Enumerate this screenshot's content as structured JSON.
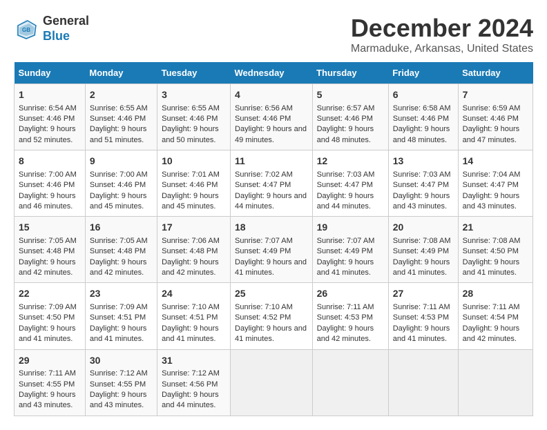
{
  "logo": {
    "line1": "General",
    "line2": "Blue"
  },
  "title": "December 2024",
  "subtitle": "Marmaduke, Arkansas, United States",
  "days_of_week": [
    "Sunday",
    "Monday",
    "Tuesday",
    "Wednesday",
    "Thursday",
    "Friday",
    "Saturday"
  ],
  "weeks": [
    [
      {
        "day": "1",
        "rise": "Sunrise: 6:54 AM",
        "set": "Sunset: 4:46 PM",
        "daylight": "Daylight: 9 hours and 52 minutes."
      },
      {
        "day": "2",
        "rise": "Sunrise: 6:55 AM",
        "set": "Sunset: 4:46 PM",
        "daylight": "Daylight: 9 hours and 51 minutes."
      },
      {
        "day": "3",
        "rise": "Sunrise: 6:55 AM",
        "set": "Sunset: 4:46 PM",
        "daylight": "Daylight: 9 hours and 50 minutes."
      },
      {
        "day": "4",
        "rise": "Sunrise: 6:56 AM",
        "set": "Sunset: 4:46 PM",
        "daylight": "Daylight: 9 hours and 49 minutes."
      },
      {
        "day": "5",
        "rise": "Sunrise: 6:57 AM",
        "set": "Sunset: 4:46 PM",
        "daylight": "Daylight: 9 hours and 48 minutes."
      },
      {
        "day": "6",
        "rise": "Sunrise: 6:58 AM",
        "set": "Sunset: 4:46 PM",
        "daylight": "Daylight: 9 hours and 48 minutes."
      },
      {
        "day": "7",
        "rise": "Sunrise: 6:59 AM",
        "set": "Sunset: 4:46 PM",
        "daylight": "Daylight: 9 hours and 47 minutes."
      }
    ],
    [
      {
        "day": "8",
        "rise": "Sunrise: 7:00 AM",
        "set": "Sunset: 4:46 PM",
        "daylight": "Daylight: 9 hours and 46 minutes."
      },
      {
        "day": "9",
        "rise": "Sunrise: 7:00 AM",
        "set": "Sunset: 4:46 PM",
        "daylight": "Daylight: 9 hours and 45 minutes."
      },
      {
        "day": "10",
        "rise": "Sunrise: 7:01 AM",
        "set": "Sunset: 4:46 PM",
        "daylight": "Daylight: 9 hours and 45 minutes."
      },
      {
        "day": "11",
        "rise": "Sunrise: 7:02 AM",
        "set": "Sunset: 4:47 PM",
        "daylight": "Daylight: 9 hours and 44 minutes."
      },
      {
        "day": "12",
        "rise": "Sunrise: 7:03 AM",
        "set": "Sunset: 4:47 PM",
        "daylight": "Daylight: 9 hours and 44 minutes."
      },
      {
        "day": "13",
        "rise": "Sunrise: 7:03 AM",
        "set": "Sunset: 4:47 PM",
        "daylight": "Daylight: 9 hours and 43 minutes."
      },
      {
        "day": "14",
        "rise": "Sunrise: 7:04 AM",
        "set": "Sunset: 4:47 PM",
        "daylight": "Daylight: 9 hours and 43 minutes."
      }
    ],
    [
      {
        "day": "15",
        "rise": "Sunrise: 7:05 AM",
        "set": "Sunset: 4:48 PM",
        "daylight": "Daylight: 9 hours and 42 minutes."
      },
      {
        "day": "16",
        "rise": "Sunrise: 7:05 AM",
        "set": "Sunset: 4:48 PM",
        "daylight": "Daylight: 9 hours and 42 minutes."
      },
      {
        "day": "17",
        "rise": "Sunrise: 7:06 AM",
        "set": "Sunset: 4:48 PM",
        "daylight": "Daylight: 9 hours and 42 minutes."
      },
      {
        "day": "18",
        "rise": "Sunrise: 7:07 AM",
        "set": "Sunset: 4:49 PM",
        "daylight": "Daylight: 9 hours and 41 minutes."
      },
      {
        "day": "19",
        "rise": "Sunrise: 7:07 AM",
        "set": "Sunset: 4:49 PM",
        "daylight": "Daylight: 9 hours and 41 minutes."
      },
      {
        "day": "20",
        "rise": "Sunrise: 7:08 AM",
        "set": "Sunset: 4:49 PM",
        "daylight": "Daylight: 9 hours and 41 minutes."
      },
      {
        "day": "21",
        "rise": "Sunrise: 7:08 AM",
        "set": "Sunset: 4:50 PM",
        "daylight": "Daylight: 9 hours and 41 minutes."
      }
    ],
    [
      {
        "day": "22",
        "rise": "Sunrise: 7:09 AM",
        "set": "Sunset: 4:50 PM",
        "daylight": "Daylight: 9 hours and 41 minutes."
      },
      {
        "day": "23",
        "rise": "Sunrise: 7:09 AM",
        "set": "Sunset: 4:51 PM",
        "daylight": "Daylight: 9 hours and 41 minutes."
      },
      {
        "day": "24",
        "rise": "Sunrise: 7:10 AM",
        "set": "Sunset: 4:51 PM",
        "daylight": "Daylight: 9 hours and 41 minutes."
      },
      {
        "day": "25",
        "rise": "Sunrise: 7:10 AM",
        "set": "Sunset: 4:52 PM",
        "daylight": "Daylight: 9 hours and 41 minutes."
      },
      {
        "day": "26",
        "rise": "Sunrise: 7:11 AM",
        "set": "Sunset: 4:53 PM",
        "daylight": "Daylight: 9 hours and 42 minutes."
      },
      {
        "day": "27",
        "rise": "Sunrise: 7:11 AM",
        "set": "Sunset: 4:53 PM",
        "daylight": "Daylight: 9 hours and 41 minutes."
      },
      {
        "day": "28",
        "rise": "Sunrise: 7:11 AM",
        "set": "Sunset: 4:54 PM",
        "daylight": "Daylight: 9 hours and 42 minutes."
      }
    ],
    [
      {
        "day": "29",
        "rise": "Sunrise: 7:11 AM",
        "set": "Sunset: 4:55 PM",
        "daylight": "Daylight: 9 hours and 43 minutes."
      },
      {
        "day": "30",
        "rise": "Sunrise: 7:12 AM",
        "set": "Sunset: 4:55 PM",
        "daylight": "Daylight: 9 hours and 43 minutes."
      },
      {
        "day": "31",
        "rise": "Sunrise: 7:12 AM",
        "set": "Sunset: 4:56 PM",
        "daylight": "Daylight: 9 hours and 44 minutes."
      },
      null,
      null,
      null,
      null
    ]
  ]
}
